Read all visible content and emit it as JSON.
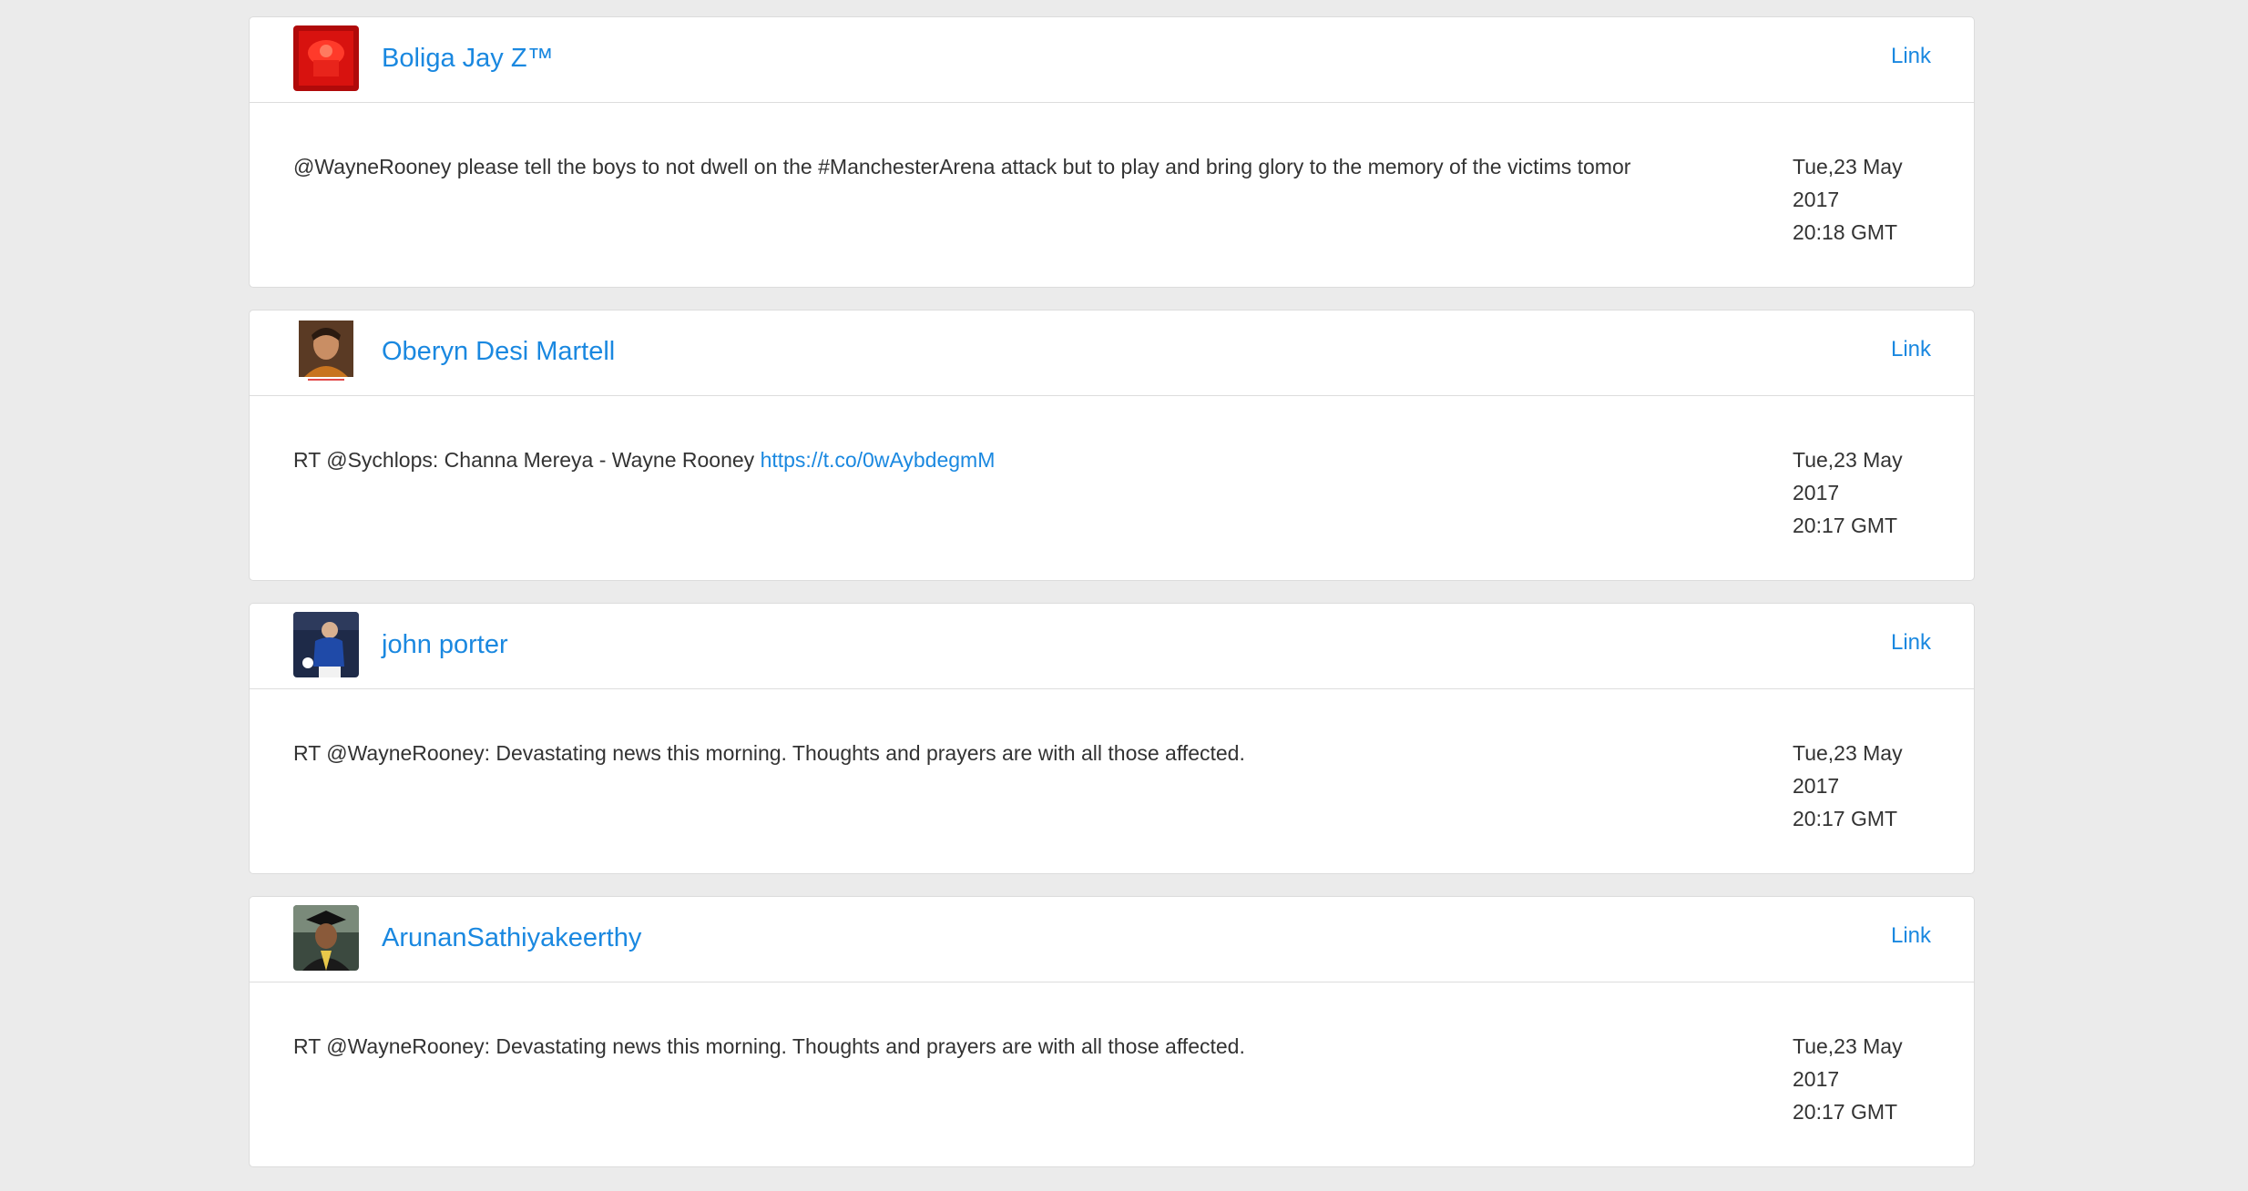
{
  "tweets": [
    {
      "user": "Boliga Jay Z™",
      "avatar_icon": "red-avatar-icon",
      "link_label": "Link",
      "text": "@WayneRooney please tell the boys to not dwell on the #ManchesterArena attack but to play and bring glory to the memory of the victims tomor",
      "url": "",
      "date": "Tue,23 May",
      "year": "2017",
      "time": "20:18 GMT"
    },
    {
      "user": "Oberyn Desi Martell",
      "avatar_icon": "portrait-avatar-icon",
      "link_label": "Link",
      "text": "RT @Sychlops: Channa Mereya - Wayne Rooney ",
      "url": "https://t.co/0wAybdegmM",
      "date": "Tue,23 May",
      "year": "2017",
      "time": "20:17 GMT"
    },
    {
      "user": "john porter",
      "avatar_icon": "footballer-avatar-icon",
      "link_label": "Link",
      "text": "RT @WayneRooney: Devastating news this morning. Thoughts and prayers are with all those affected.",
      "url": "",
      "date": "Tue,23 May",
      "year": "2017",
      "time": "20:17 GMT"
    },
    {
      "user": "ArunanSathiyakeerthy",
      "avatar_icon": "graduate-avatar-icon",
      "link_label": "Link",
      "text": "RT @WayneRooney: Devastating news this morning. Thoughts and prayers are with all those affected.",
      "url": "",
      "date": "Tue,23 May",
      "year": "2017",
      "time": "20:17 GMT"
    }
  ],
  "colors": {
    "accent": "#1a88e0",
    "background": "#ebebeb",
    "card": "#ffffff",
    "text": "#333333"
  }
}
